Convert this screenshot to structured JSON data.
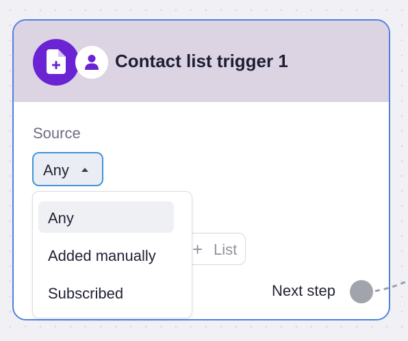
{
  "node": {
    "title": "Contact list trigger 1",
    "icons": {
      "primary": "file-add-icon",
      "secondary": "person-icon"
    }
  },
  "source": {
    "label": "Source",
    "selected_value": "Any",
    "options": [
      "Any",
      "Added manually",
      "Subscribed"
    ]
  },
  "add_list": {
    "label": "List",
    "icon": "plus-icon"
  },
  "next_step": {
    "label": "Next step"
  },
  "colors": {
    "accent_purple": "#6a24d4",
    "header_bg": "#dcd3e3",
    "card_border": "#4f7fe0",
    "select_border": "#3f93d8",
    "handle": "#a2a4ad"
  }
}
